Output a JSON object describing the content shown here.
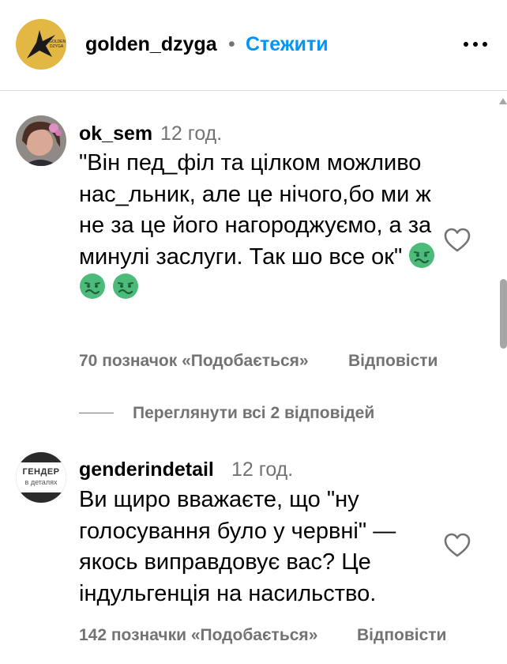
{
  "header": {
    "avatar_icon": "golden-dzyga-logo-icon",
    "avatar_text": "GOLDEN DZYGA",
    "username": "golden_dzyga",
    "separator": "•",
    "follow_label": "Стежити",
    "more_icon": "more-options-icon"
  },
  "comments": [
    {
      "username": "ok_sem",
      "time": "12 год.",
      "text": "\"Він пед_філ та цілком можливо нас_льник, але це нічого,бо ми ж не за це його нагороджуємо, а за минулі заслуги. Так шо все ок\"",
      "emojis": [
        "nauseated-face-emoji",
        "nauseated-face-emoji",
        "nauseated-face-emoji"
      ],
      "likes": "70 позначок «Подобається»",
      "reply_label": "Відповісти",
      "like_icon": "heart-outline-icon"
    },
    {
      "username": "genderindetail",
      "time": "12 год.",
      "text": "Ви щиро вважаєте, що \"ну голосування було у червні\" — якось виправдовує вас? Це індульгенція на насильство.",
      "likes": "142 позначки «Подобається»",
      "reply_label": "Відповісти",
      "like_icon": "heart-outline-icon",
      "avatar_line1": "ГЕНДЕР",
      "avatar_line2": "в деталях"
    }
  ],
  "view_replies_label": "Переглянути всі 2 відповідей",
  "colors": {
    "accent": "#0095f6",
    "muted": "#737373",
    "divider": "#dbdbdb",
    "logo_gold": "#e2b744",
    "emoji_green": "#4cbb7a"
  }
}
